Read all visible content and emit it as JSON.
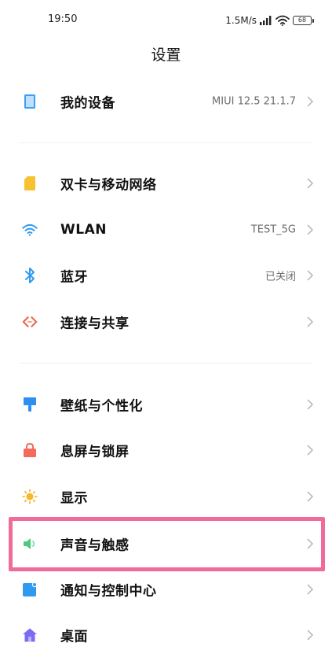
{
  "status_bar": {
    "time": "19:50",
    "network_speed": "1.5M/s",
    "battery": "68",
    "signal_icon": "signal-bars-icon",
    "wifi_icon": "wifi-icon"
  },
  "page": {
    "title": "设置"
  },
  "groups": [
    {
      "items": [
        {
          "id": "my-device",
          "label": "我的设备",
          "value": "MIUI 12.5 21.1.7",
          "icon": "phone-device-icon",
          "color": "#3aa0f5"
        }
      ]
    },
    {
      "items": [
        {
          "id": "sim-network",
          "label": "双卡与移动网络",
          "value": "",
          "icon": "sim-card-icon",
          "color": "#f6c232"
        },
        {
          "id": "wlan",
          "label": "WLAN",
          "value": "TEST_5G",
          "icon": "wifi-icon",
          "color": "#2e9bf0"
        },
        {
          "id": "bluetooth",
          "label": "蓝牙",
          "value": "已关闭",
          "icon": "bluetooth-icon",
          "color": "#2e9bf0"
        },
        {
          "id": "connection-sharing",
          "label": "连接与共享",
          "value": "",
          "icon": "connection-share-icon",
          "color": "#ee6a4e"
        }
      ]
    },
    {
      "items": [
        {
          "id": "wallpaper",
          "label": "壁纸与个性化",
          "value": "",
          "icon": "paint-brush-icon",
          "color": "#2e8ff0"
        },
        {
          "id": "lock-screen",
          "label": "息屏与锁屏",
          "value": "",
          "icon": "lock-icon",
          "color": "#f26b5b"
        },
        {
          "id": "display",
          "label": "显示",
          "value": "",
          "icon": "sun-icon",
          "color": "#f5b92e"
        },
        {
          "id": "sound",
          "label": "声音与触感",
          "value": "",
          "icon": "speaker-icon",
          "color": "#4cc97a"
        },
        {
          "id": "notification",
          "label": "通知与控制中心",
          "value": "",
          "icon": "notification-icon",
          "color": "#2e9bf0"
        },
        {
          "id": "home-screen",
          "label": "桌面",
          "value": "",
          "icon": "home-icon",
          "color": "#7b6cf2"
        }
      ]
    }
  ],
  "highlight_color": "#f06b9c"
}
